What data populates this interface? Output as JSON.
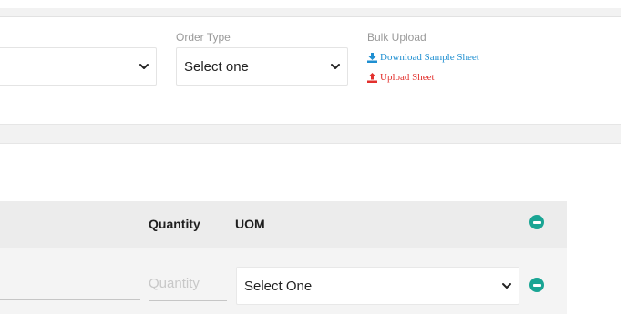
{
  "filters": {
    "left_select_value": "",
    "order_type": {
      "label": "Order Type",
      "selected": "Select one"
    }
  },
  "bulk_upload": {
    "label": "Bulk Upload",
    "download_link": "Download Sample Sheet",
    "upload_link": "Upload Sheet"
  },
  "table": {
    "headers": {
      "quantity": "Quantity",
      "uom": "UOM"
    },
    "row": {
      "quantity_placeholder": "Quantity",
      "uom_selected": "Select One"
    }
  },
  "colors": {
    "accent_teal": "#1aa594",
    "download_blue": "#1f8fd1",
    "upload_red": "#e2302d"
  },
  "icons": {
    "download": "download-icon",
    "upload": "upload-icon",
    "remove": "minus-circle-icon",
    "dropdown": "chevron-down-icon"
  }
}
